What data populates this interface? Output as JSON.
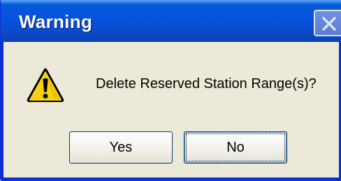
{
  "window": {
    "title": "Warning"
  },
  "dialog": {
    "message": "Delete Reserved Station Range(s)?",
    "icon": "warning-icon"
  },
  "buttons": {
    "yes_label": "Yes",
    "no_label": "No"
  },
  "colors": {
    "titlebar": "#0453e0",
    "dialog_background": "#ece9d8",
    "warning_yellow": "#f7d10e"
  }
}
